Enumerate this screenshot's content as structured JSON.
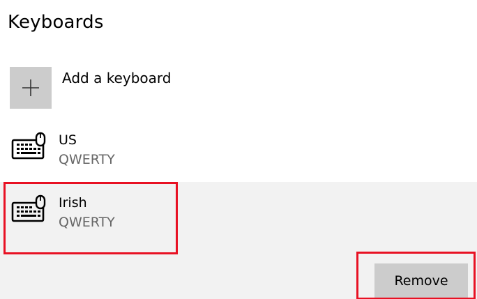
{
  "page": {
    "title": "Keyboards"
  },
  "add_keyboard": {
    "label": "Add a keyboard",
    "icon": "plus-icon"
  },
  "keyboards": [
    {
      "name": "US",
      "layout": "QWERTY",
      "icon": "keyboard-icon",
      "selected": false
    },
    {
      "name": "Irish",
      "layout": "QWERTY",
      "icon": "keyboard-icon",
      "selected": true
    }
  ],
  "actions": {
    "remove_label": "Remove"
  },
  "colors": {
    "highlight": "#e81123",
    "selected_background": "#f2f2f2",
    "button_background": "#cccccc",
    "secondary_text": "#666666"
  }
}
